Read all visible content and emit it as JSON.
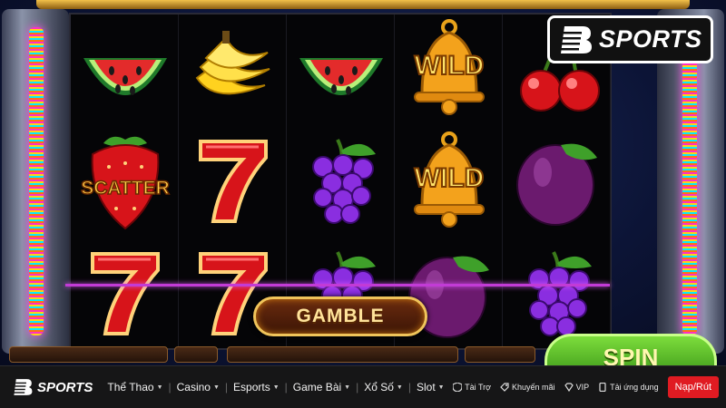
{
  "game": {
    "reels": [
      [
        "watermelon",
        "strawberry-scatter",
        "seven"
      ],
      [
        "banana",
        "seven",
        "seven"
      ],
      [
        "watermelon",
        "grapes",
        "grapes"
      ],
      [
        "wild-bell",
        "wild-bell",
        "plum"
      ],
      [
        "cherry",
        "plum",
        "grapes"
      ]
    ],
    "wild_label": "WILD",
    "scatter_label": "SCATTER",
    "gamble_label": "GAMBLE",
    "spin_label": "SPIN",
    "colors": {
      "accent_gold": "#f0c45a",
      "payline": "#c23bd6",
      "spin_green": "#4fb81e"
    }
  },
  "brand": {
    "logo_text": "SPORTS",
    "logo_icon": "b-logo-icon"
  },
  "nav": {
    "logo_text": "SPORTS",
    "menu": [
      {
        "label": "Thể Thao",
        "has_dropdown": true
      },
      {
        "label": "Casino",
        "has_dropdown": true
      },
      {
        "label": "Esports",
        "has_dropdown": true
      },
      {
        "label": "Game Bài",
        "has_dropdown": true
      },
      {
        "label": "Xổ Số",
        "has_dropdown": true
      },
      {
        "label": "Slot",
        "has_dropdown": true
      }
    ],
    "links": [
      {
        "label": "Tài Trợ",
        "icon": "shield-icon"
      },
      {
        "label": "Khuyến mãi",
        "icon": "tag-icon"
      },
      {
        "label": "VIP",
        "icon": "diamond-icon"
      },
      {
        "label": "Tải ứng dụng",
        "icon": "phone-icon"
      }
    ],
    "cta_label": "Nạp/Rút",
    "cta_color": "#e01b22"
  }
}
